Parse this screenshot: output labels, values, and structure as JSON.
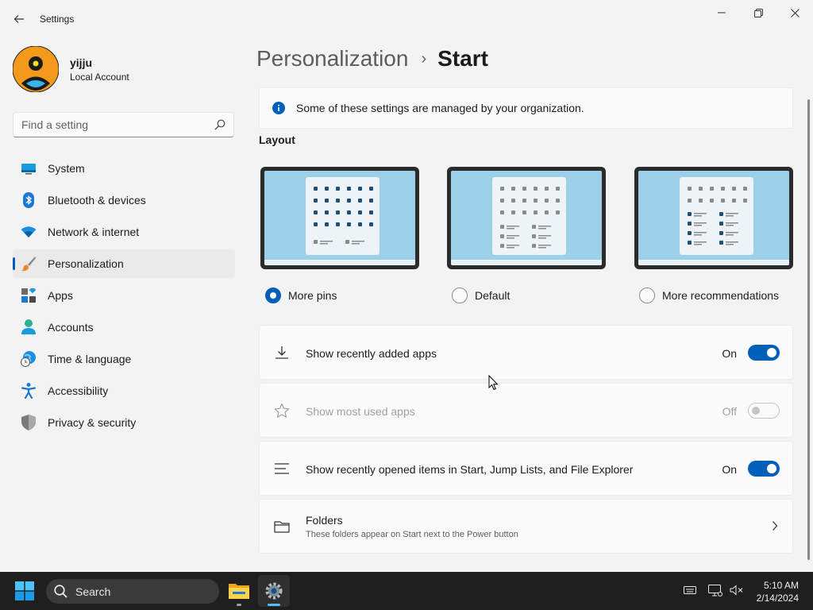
{
  "window": {
    "title": "Settings"
  },
  "profile": {
    "name": "yijju",
    "account_type": "Local Account"
  },
  "search": {
    "placeholder": "Find a setting"
  },
  "sidebar": {
    "items": [
      {
        "label": "System",
        "icon": "monitor-icon"
      },
      {
        "label": "Bluetooth & devices",
        "icon": "bluetooth-icon"
      },
      {
        "label": "Network & internet",
        "icon": "wifi-icon"
      },
      {
        "label": "Personalization",
        "icon": "paintbrush-icon",
        "active": true
      },
      {
        "label": "Apps",
        "icon": "apps-icon"
      },
      {
        "label": "Accounts",
        "icon": "person-icon"
      },
      {
        "label": "Time & language",
        "icon": "globe-clock-icon"
      },
      {
        "label": "Accessibility",
        "icon": "accessibility-icon"
      },
      {
        "label": "Privacy & security",
        "icon": "shield-icon"
      }
    ]
  },
  "breadcrumb": {
    "parent": "Personalization",
    "separator": "›",
    "current": "Start"
  },
  "info": {
    "text": "Some of these settings are managed by your organization."
  },
  "layout": {
    "title": "Layout",
    "options": [
      {
        "label": "More pins",
        "checked": true
      },
      {
        "label": "Default",
        "checked": false
      },
      {
        "label": "More recommendations",
        "checked": false
      }
    ]
  },
  "settings": [
    {
      "label": "Show recently added apps",
      "state": "On",
      "enabled": true,
      "icon": "download-icon"
    },
    {
      "label": "Show most used apps",
      "state": "Off",
      "enabled": false,
      "icon": "star-icon"
    },
    {
      "label": "Show recently opened items in Start, Jump Lists, and File Explorer",
      "state": "On",
      "enabled": true,
      "icon": "list-icon"
    }
  ],
  "folders": {
    "title": "Folders",
    "subtitle": "These folders appear on Start next to the Power button",
    "icon": "folder-icon"
  },
  "taskbar": {
    "search_label": "Search",
    "time": "5:10 AM",
    "date": "2/14/2024"
  },
  "colors": {
    "accent": "#005fb8",
    "preview_bg": "#9ccfe8",
    "taskbar": "#1f1f1f"
  }
}
